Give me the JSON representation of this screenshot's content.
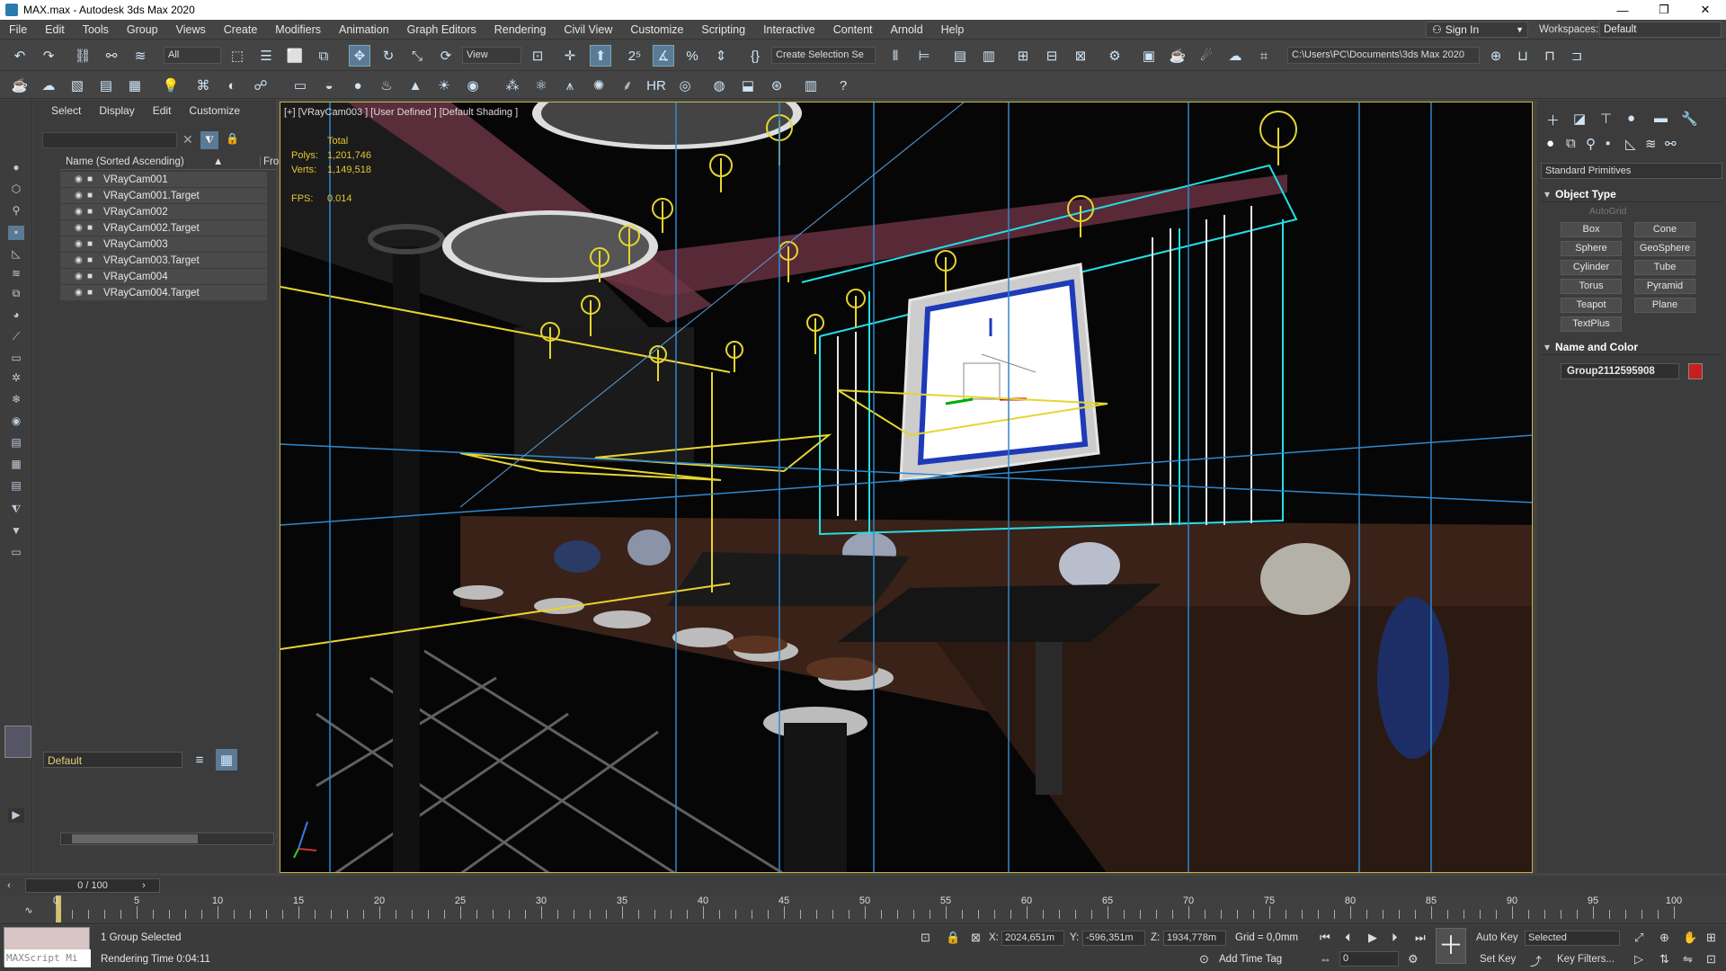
{
  "window": {
    "title": "MAX.max - Autodesk 3ds Max 2020",
    "min": "—",
    "max": "❐",
    "close": "✕"
  },
  "menu": [
    "File",
    "Edit",
    "Tools",
    "Group",
    "Views",
    "Create",
    "Modifiers",
    "Animation",
    "Graph Editors",
    "Rendering",
    "Civil View",
    "Customize",
    "Scripting",
    "Interactive",
    "Content",
    "Arnold",
    "Help"
  ],
  "account": {
    "sign_in": "Sign In",
    "workspace_label": "Workspaces:",
    "workspace": "Default"
  },
  "toolbar": {
    "filter": "All",
    "ref_coord": "View",
    "selection_set": "Create Selection Se",
    "project_path": "C:\\Users\\PC\\Documents\\3ds Max 2020"
  },
  "scene_explorer": {
    "tabs": [
      "Select",
      "Display",
      "Edit",
      "Customize"
    ],
    "column_name": "Name (Sorted Ascending)",
    "column_frozen": "Fro",
    "sort_arrow": "▲",
    "items": [
      "VRayCam001",
      "VRayCam001.Target",
      "VRayCam002",
      "VRayCam002.Target",
      "VRayCam003",
      "VRayCam003.Target",
      "VRayCam004",
      "VRayCam004.Target"
    ],
    "layer": "Default"
  },
  "viewport": {
    "label": "[+] [VRayCam003 ] [User Defined ] [Default Shading ]",
    "stats": {
      "total_label": "Total",
      "polys_label": "Polys:",
      "polys": "1,201,746",
      "verts_label": "Verts:",
      "verts": "1,149,518",
      "fps_label": "FPS:",
      "fps": "0.014"
    }
  },
  "command_panel": {
    "category": "Standard Primitives",
    "object_type_title": "Object Type",
    "autogrid": "AutoGrid",
    "primitives": [
      "Box",
      "Cone",
      "Sphere",
      "GeoSphere",
      "Cylinder",
      "Tube",
      "Torus",
      "Pyramid",
      "Teapot",
      "Plane",
      "TextPlus"
    ],
    "name_color_title": "Name and Color",
    "object_name": "Group2112595908",
    "object_color": "#c51f1f"
  },
  "timeline": {
    "frame_display": "0 / 100",
    "ticks": [
      0,
      5,
      10,
      15,
      20,
      25,
      30,
      35,
      40,
      45,
      50,
      55,
      60,
      65,
      70,
      75,
      80,
      85,
      90,
      95,
      100
    ]
  },
  "status": {
    "maxscript": "MAXScript Mi",
    "selection": "1 Group Selected",
    "render_time": "Rendering Time  0:04:11",
    "x_label": "X:",
    "x": "2024,651m",
    "y_label": "Y:",
    "y": "-596,351m",
    "z_label": "Z:",
    "z": "1934,778m",
    "grid": "Grid = 0,0mm",
    "add_time_tag": "Add Time Tag",
    "auto_key": "Auto Key",
    "set_key": "Set Key",
    "key_mode": "Selected",
    "key_filters": "Key Filters...",
    "frame": "0"
  }
}
